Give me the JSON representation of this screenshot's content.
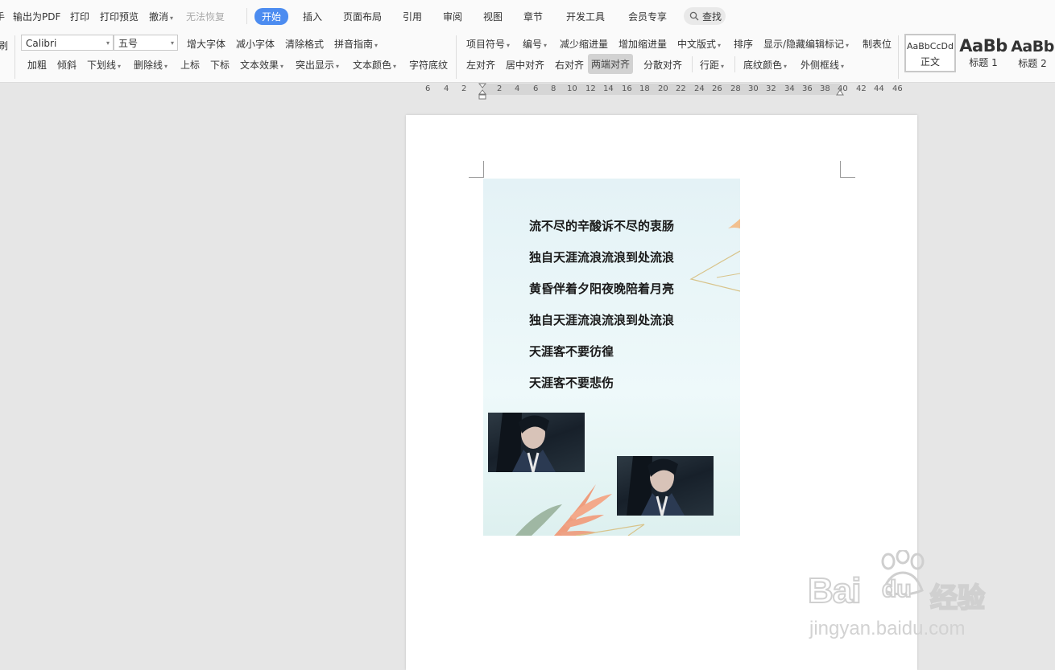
{
  "app": {
    "left_edge_glyph": "手",
    "quick_menu": [
      {
        "label": "输出为PDF",
        "disabled": false
      },
      {
        "label": "打印",
        "disabled": false
      },
      {
        "label": "打印预览",
        "disabled": false
      },
      {
        "label": "撤消",
        "disabled": false
      },
      {
        "label": "无法恢复",
        "disabled": true
      }
    ],
    "tabs": [
      "开始",
      "插入",
      "页面布局",
      "引用",
      "审阅",
      "视图",
      "章节",
      "开发工具",
      "会员专享"
    ],
    "active_tab": "开始",
    "search_label": "查找"
  },
  "ribbon": {
    "left_edge_glyph": "刷",
    "font_name": "Calibri",
    "font_size": "五号",
    "row1_font": [
      "增大字体",
      "减小字体",
      "清除格式",
      "拼音指南"
    ],
    "row2_font": [
      "加粗",
      "倾斜",
      "下划线",
      "删除线",
      "上标",
      "下标",
      "文本效果",
      "突出显示",
      "文本颜色",
      "字符底纹"
    ],
    "row1_para": [
      "项目符号",
      "编号",
      "减少缩进量",
      "增加缩进量",
      "中文版式",
      "排序",
      "显示/隐藏编辑标记",
      "制表位"
    ],
    "row2_para": [
      "左对齐",
      "居中对齐",
      "右对齐",
      "两端对齐",
      "分散对齐",
      "行距",
      "底纹颜色",
      "外侧框线"
    ],
    "active_align": "两端对齐",
    "styles": [
      {
        "sample": "AaBbCcDd",
        "name": "正文"
      },
      {
        "sample": "AaBb",
        "name": "标题 1"
      },
      {
        "sample": "AaBb",
        "name": "标题 2"
      }
    ]
  },
  "ruler": {
    "left_ticks": [
      "6",
      "4",
      "2"
    ],
    "right_ticks": [
      "2",
      "4",
      "6",
      "8",
      "10",
      "12",
      "14",
      "16",
      "18",
      "20",
      "22",
      "24",
      "26",
      "28",
      "30",
      "32",
      "34",
      "36",
      "38",
      "40",
      "42",
      "44",
      "46"
    ]
  },
  "document": {
    "poster_lines": [
      "流不尽的辛酸诉不尽的衷肠",
      "独自天涯流浪流浪到处流浪",
      "黄昏伴着夕阳夜晚陪着月亮",
      "独自天涯流浪流浪到处流浪",
      "天涯客不要彷徨",
      "天涯客不要悲伤"
    ]
  },
  "watermark": {
    "brand": "Bai",
    "brand_du": "du",
    "product": "经验",
    "url": "jingyan.baidu.com"
  },
  "colors": {
    "accent": "#4c8cf0",
    "ribbon_bg": "#fafafa",
    "workspace_bg": "#e6e6e6"
  }
}
